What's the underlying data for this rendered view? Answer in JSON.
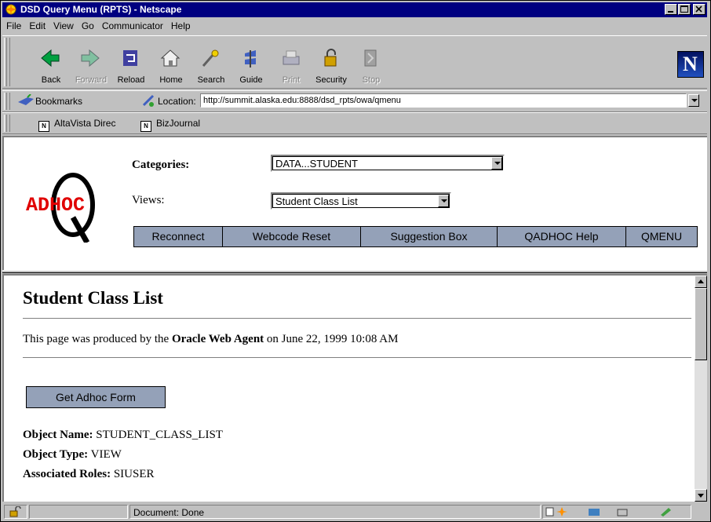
{
  "window": {
    "title": "DSD Query Menu (RPTS) - Netscape"
  },
  "menu": {
    "items": [
      "File",
      "Edit",
      "View",
      "Go",
      "Communicator",
      "Help"
    ]
  },
  "toolbar": {
    "buttons": [
      {
        "label": "Back",
        "icon": "back-arrow-icon",
        "enabled": true
      },
      {
        "label": "Forward",
        "icon": "forward-arrow-icon",
        "enabled": false
      },
      {
        "label": "Reload",
        "icon": "reload-icon",
        "enabled": true
      },
      {
        "label": "Home",
        "icon": "home-icon",
        "enabled": true
      },
      {
        "label": "Search",
        "icon": "search-icon",
        "enabled": true
      },
      {
        "label": "Guide",
        "icon": "guide-icon",
        "enabled": true
      },
      {
        "label": "Print",
        "icon": "printer-icon",
        "enabled": false
      },
      {
        "label": "Security",
        "icon": "padlock-icon",
        "enabled": true
      },
      {
        "label": "Stop",
        "icon": "stop-icon",
        "enabled": false
      }
    ]
  },
  "location": {
    "bookmarks_label": "Bookmarks",
    "location_label": "Location:",
    "url": "http://summit.alaska.edu:8888/dsd_rpts/owa/qmenu"
  },
  "personal_toolbar": {
    "items": [
      "AltaVista Direc",
      "BizJournal"
    ]
  },
  "query_header": {
    "logo_text": "ADHOC",
    "categories_label": "Categories:",
    "categories_value": "DATA...STUDENT",
    "views_label": "Views:",
    "views_value": "Student Class List",
    "nav_buttons": [
      "Reconnect",
      "Webcode Reset",
      "Suggestion Box",
      "QADHOC Help",
      "QMENU"
    ]
  },
  "content": {
    "heading": "Student Class List",
    "produced_prefix": "This page was produced by the ",
    "produced_agent": "Oracle Web Agent",
    "produced_suffix": " on June 22, 1999 10:08 AM",
    "get_form_button": "Get Adhoc Form",
    "object_name_label": "Object Name:",
    "object_name_value": " STUDENT_CLASS_LIST",
    "object_type_label": "Object Type:",
    "object_type_value": " VIEW",
    "roles_label": "Associated Roles:",
    "roles_value": " SIUSER"
  },
  "status": {
    "text": "Document: Done"
  },
  "colors": {
    "title_bar": "#000080",
    "button_fill": "#94a1b8",
    "logo_red": "#e00000"
  }
}
